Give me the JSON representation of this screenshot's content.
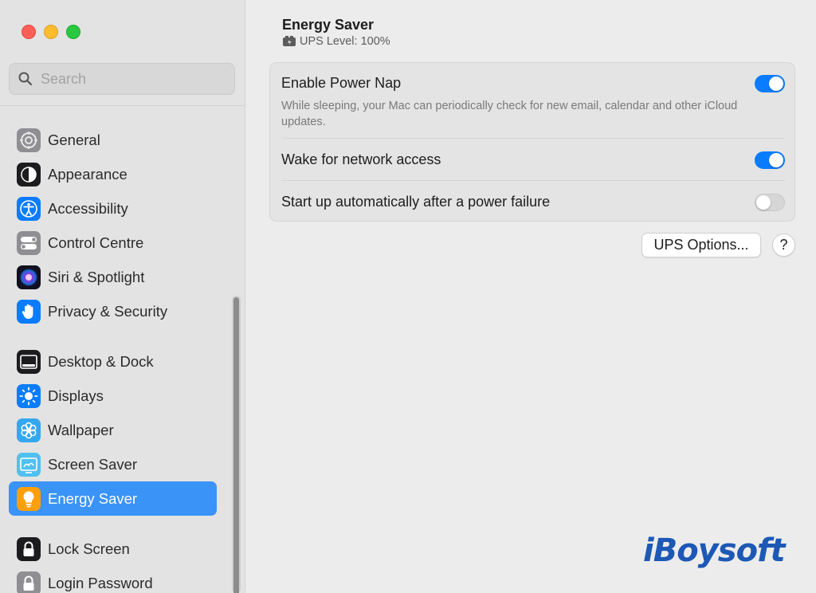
{
  "window": {
    "traffic_lights": [
      "close",
      "minimize",
      "maximize"
    ]
  },
  "search": {
    "placeholder": "Search"
  },
  "sidebar": {
    "groups": [
      {
        "items": [
          {
            "label": "General",
            "icon": "gear-icon",
            "color": "#8e8e93"
          },
          {
            "label": "Appearance",
            "icon": "appearance-icon",
            "color": "#1c1c1e"
          },
          {
            "label": "Accessibility",
            "icon": "accessibility-icon",
            "color": "#0a7cff"
          },
          {
            "label": "Control Centre",
            "icon": "control-centre-icon",
            "color": "#8e8e93"
          },
          {
            "label": "Siri & Spotlight",
            "icon": "siri-icon",
            "color": "#b044d8"
          },
          {
            "label": "Privacy & Security",
            "icon": "hand-icon",
            "color": "#0a7cff"
          }
        ]
      },
      {
        "items": [
          {
            "label": "Desktop & Dock",
            "icon": "dock-icon",
            "color": "#1c1c1e"
          },
          {
            "label": "Displays",
            "icon": "sun-icon",
            "color": "#0a7cff"
          },
          {
            "label": "Wallpaper",
            "icon": "flower-icon",
            "color": "#35a7f0"
          },
          {
            "label": "Screen Saver",
            "icon": "screen-saver-icon",
            "color": "#4fc1f1"
          },
          {
            "label": "Energy Saver",
            "icon": "lightbulb-icon",
            "color": "#ff9f0a",
            "active": true
          }
        ]
      },
      {
        "items": [
          {
            "label": "Lock Screen",
            "icon": "lock-icon",
            "color": "#1c1c1e"
          },
          {
            "label": "Login Password",
            "icon": "lock-icon",
            "color": "#8e8e93"
          }
        ]
      }
    ]
  },
  "main": {
    "title": "Energy Saver",
    "ups_level": "UPS Level: 100%",
    "settings": [
      {
        "title": "Enable Power Nap",
        "description": "While sleeping, your Mac can periodically check for new email, calendar and other iCloud updates.",
        "on": true
      },
      {
        "title": "Wake for network access",
        "on": true
      },
      {
        "title": "Start up automatically after a power failure",
        "on": false
      }
    ],
    "ups_options_label": "UPS Options...",
    "help_label": "?"
  },
  "watermark": "iBoysoft",
  "colors": {
    "accent": "#0a7cff",
    "selection": "#3a93f7"
  }
}
